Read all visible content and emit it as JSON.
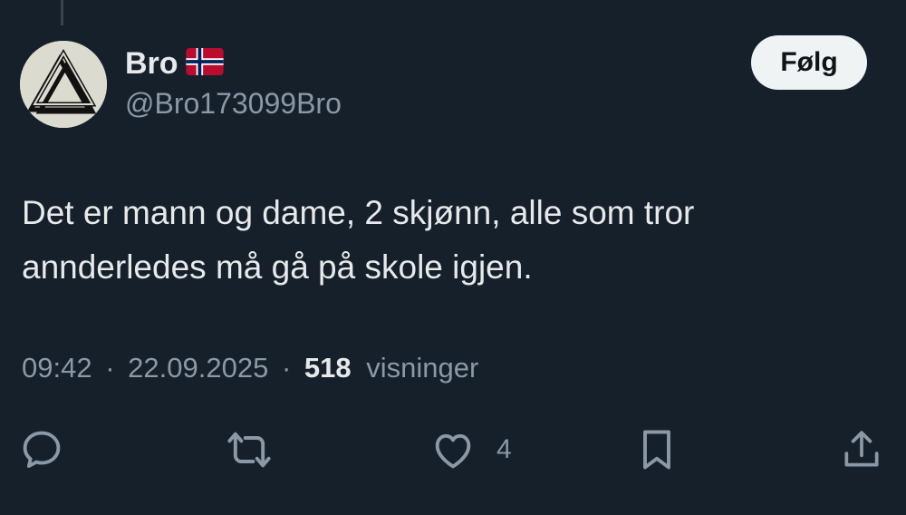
{
  "user": {
    "display_name": "Bro",
    "handle": "@Bro173099Bro",
    "flag": "norway-flag"
  },
  "follow_button": {
    "label": "Følg"
  },
  "tweet": {
    "lines": [
      "Det er mann og dame, 2 skjønn, alle som tror",
      "annderledes må gå på skole igjen."
    ]
  },
  "meta": {
    "time": "09:42",
    "separator": "·",
    "date": "22.09.2025",
    "views_count": "518",
    "views_label": "visninger"
  },
  "actions": {
    "reply_icon": "reply-icon",
    "retweet_icon": "retweet-icon",
    "like_icon": "like-icon",
    "like_count": "4",
    "bookmark_icon": "bookmark-icon",
    "share_icon": "share-icon"
  },
  "colors": {
    "background": "#15202b",
    "primary_text": "#e7e9ea",
    "secondary_text": "#8b98a5",
    "button_bg": "#eff3f4"
  }
}
